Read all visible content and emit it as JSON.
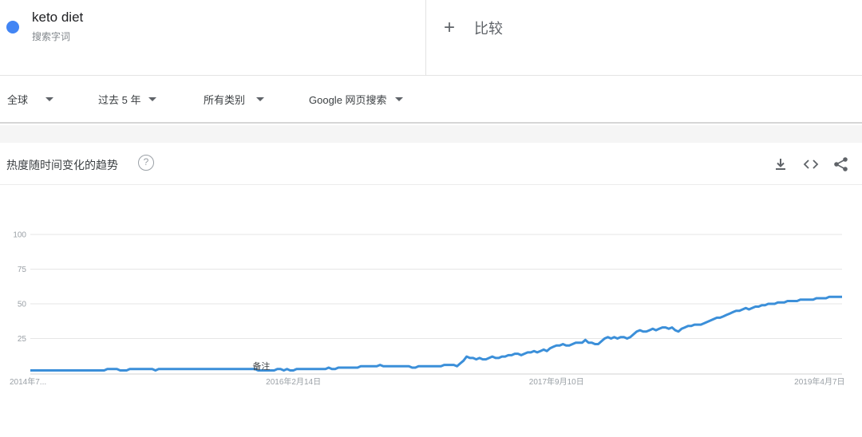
{
  "term": {
    "name": "keto diet",
    "subtitle": "搜索字词",
    "color": "#4285f4"
  },
  "compare": {
    "icon": "plus-icon",
    "label": "比较"
  },
  "filters": {
    "region": "全球",
    "time": "过去 5 年",
    "category": "所有类别",
    "search_type": "Google 网页搜索"
  },
  "panel": {
    "title": "热度随时间变化的趋势",
    "help_icon": "question-mark-icon",
    "actions": [
      "download-icon",
      "embed-code-icon",
      "share-icon"
    ]
  },
  "chart_data": {
    "type": "line",
    "ylim": [
      0,
      100
    ],
    "yticks": [
      25,
      50,
      75,
      100
    ],
    "xtick_labels": [
      "2014年7...",
      "2016年2月14日",
      "2017年9月10日",
      "2019年4月7日"
    ],
    "xtick_index": [
      0,
      82,
      164,
      246
    ],
    "grid": true,
    "line_color": "#3b8fd9",
    "annotation": {
      "label": "备注",
      "index": 72
    },
    "series": [
      {
        "values": [
          2,
          2,
          2,
          2,
          2,
          2,
          2,
          2,
          2,
          2,
          2,
          2,
          2,
          2,
          2,
          2,
          2,
          2,
          2,
          2,
          2,
          2,
          2,
          2,
          3,
          3,
          3,
          3,
          2,
          2,
          2,
          3,
          3,
          3,
          3,
          3,
          3,
          3,
          3,
          2,
          3,
          3,
          3,
          3,
          3,
          3,
          3,
          3,
          3,
          3,
          3,
          3,
          3,
          3,
          3,
          3,
          3,
          3,
          3,
          3,
          3,
          3,
          3,
          3,
          3,
          3,
          3,
          3,
          3,
          3,
          3,
          2,
          2,
          2,
          2,
          2,
          2,
          3,
          3,
          2,
          3,
          2,
          2,
          3,
          3,
          3,
          3,
          3,
          3,
          3,
          3,
          3,
          3,
          4,
          3,
          3,
          4,
          4,
          4,
          4,
          4,
          4,
          4,
          5,
          5,
          5,
          5,
          5,
          5,
          6,
          5,
          5,
          5,
          5,
          5,
          5,
          5,
          5,
          5,
          4,
          4,
          5,
          5,
          5,
          5,
          5,
          5,
          5,
          5,
          6,
          6,
          6,
          6,
          5,
          7,
          9,
          12,
          11,
          11,
          10,
          11,
          10,
          10,
          11,
          12,
          11,
          11,
          12,
          12,
          13,
          13,
          14,
          14,
          13,
          14,
          15,
          15,
          16,
          15,
          16,
          17,
          16,
          18,
          19,
          20,
          20,
          21,
          20,
          20,
          21,
          22,
          22,
          22,
          24,
          22,
          22,
          21,
          21,
          23,
          25,
          26,
          25,
          26,
          25,
          26,
          26,
          25,
          26,
          28,
          30,
          31,
          30,
          30,
          31,
          32,
          31,
          32,
          33,
          33,
          32,
          33,
          31,
          30,
          32,
          33,
          34,
          34,
          35,
          35,
          35,
          36,
          37,
          38,
          39,
          40,
          40,
          41,
          42,
          43,
          44,
          45,
          45,
          46,
          47,
          46,
          47,
          48,
          48,
          49,
          49,
          50,
          50,
          50,
          51,
          51,
          51,
          52,
          52,
          52,
          52,
          53,
          53,
          53,
          53,
          53,
          54,
          54,
          54,
          54,
          55,
          55,
          55,
          55,
          55
        ],
        "note": "weekly interest, read off the plot"
      }
    ]
  }
}
